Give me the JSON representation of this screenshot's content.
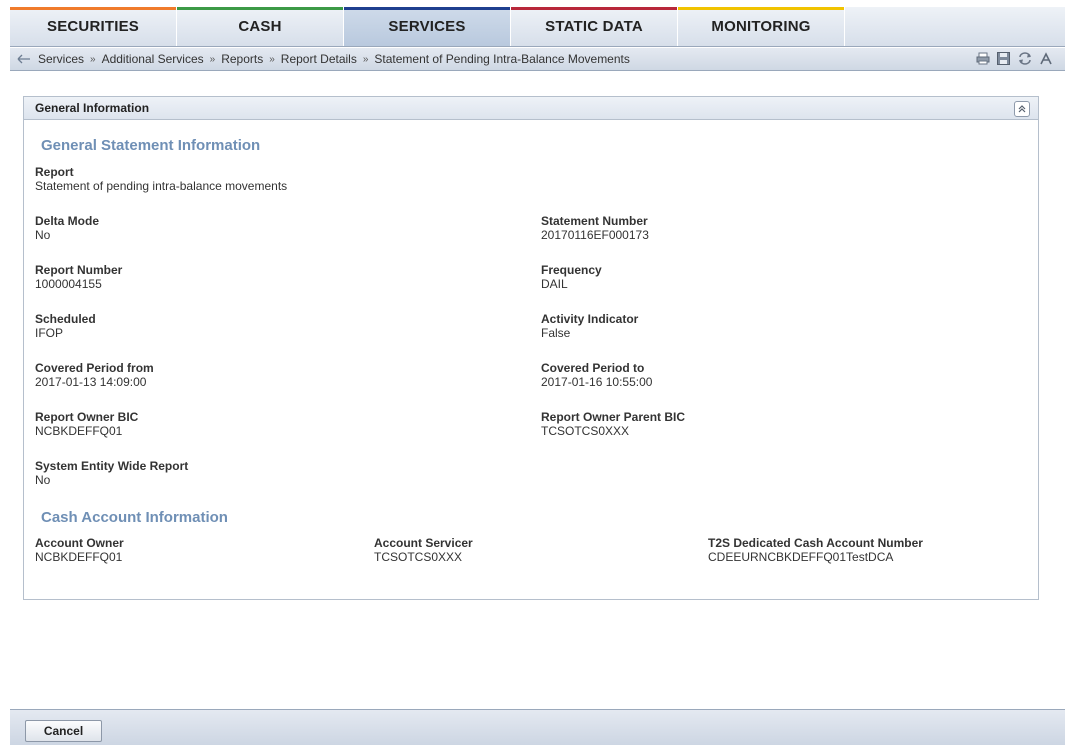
{
  "colors": {
    "securities": "#f07b2b",
    "cash": "#3c9a46",
    "services": "#1f3f8f",
    "static_data": "#b8283a",
    "monitoring": "#f1c300",
    "section_title": "#6f8fb5"
  },
  "nav": {
    "tabs": [
      {
        "label": "SECURITIES",
        "color": "#f07b2b"
      },
      {
        "label": "CASH",
        "color": "#3c9a46"
      },
      {
        "label": "SERVICES",
        "color": "#1f3f8f"
      },
      {
        "label": "STATIC DATA",
        "color": "#b8283a"
      },
      {
        "label": "MONITORING",
        "color": "#f1c300"
      }
    ],
    "active": "SERVICES"
  },
  "breadcrumb": {
    "items": [
      "Services",
      "Additional Services",
      "Reports",
      "Report Details",
      "Statement of Pending Intra-Balance Movements"
    ],
    "separator": "»",
    "tools": [
      "print-icon",
      "save-icon",
      "refresh-icon",
      "font-size-icon"
    ]
  },
  "panel": {
    "title": "General Information",
    "general": {
      "title": "General Statement Information",
      "report": {
        "label": "Report",
        "value": "Statement of pending intra-balance movements"
      },
      "delta_mode": {
        "label": "Delta Mode",
        "value": "No"
      },
      "statement_number": {
        "label": "Statement Number",
        "value": "20170116EF000173"
      },
      "report_number": {
        "label": "Report Number",
        "value": "1000004155"
      },
      "frequency": {
        "label": "Frequency",
        "value": "DAIL"
      },
      "scheduled": {
        "label": "Scheduled",
        "value": "IFOP"
      },
      "activity_indicator": {
        "label": "Activity Indicator",
        "value": "False"
      },
      "period_from": {
        "label": "Covered Period from",
        "value": "2017-01-13 14:09:00"
      },
      "period_to": {
        "label": "Covered Period to",
        "value": "2017-01-16 10:55:00"
      },
      "owner_bic": {
        "label": "Report Owner BIC",
        "value": "NCBKDEFFQ01"
      },
      "owner_parent_bic": {
        "label": "Report Owner Parent BIC",
        "value": "TCSOTCS0XXX"
      },
      "system_entity": {
        "label": "System Entity Wide Report",
        "value": "No"
      }
    },
    "cash": {
      "title": "Cash Account Information",
      "account_owner": {
        "label": "Account Owner",
        "value": "NCBKDEFFQ01"
      },
      "account_servicer": {
        "label": "Account Servicer",
        "value": "TCSOTCS0XXX"
      },
      "dca_number": {
        "label": "T2S Dedicated Cash Account Number",
        "value": "CDEEURNCBKDEFFQ01TestDCA"
      }
    }
  },
  "footer": {
    "cancel_label": "Cancel"
  }
}
